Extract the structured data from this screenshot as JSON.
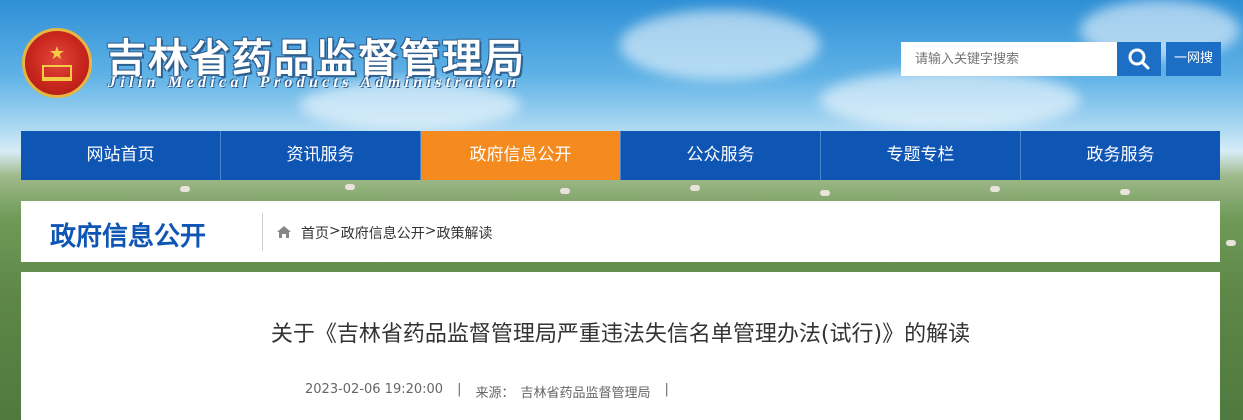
{
  "header": {
    "title": "吉林省药品监督管理局",
    "subtitle": "Jilin Medical Products Administration",
    "search_placeholder": "请输入关键字搜索",
    "search_button_icon": "search-icon",
    "one_net_label": "一网搜"
  },
  "nav": {
    "items": [
      {
        "label": "网站首页"
      },
      {
        "label": "资讯服务"
      },
      {
        "label": "政府信息公开"
      },
      {
        "label": "公众服务"
      },
      {
        "label": "专题专栏"
      },
      {
        "label": "政务服务"
      }
    ],
    "active_index": 2
  },
  "section": {
    "title": "政府信息公开",
    "breadcrumb": {
      "home": "首页",
      "sep1": ">",
      "level1": "政府信息公开",
      "sep2": ">",
      "level2": "政策解读"
    }
  },
  "article": {
    "title": "关于《吉林省药品监督管理局严重违法失信名单管理办法(试行)》的解读",
    "date": "2023-02-06 19:20:00",
    "sep": "|",
    "source_label": "来源：",
    "source_value": "吉林省药品监督管理局",
    "trailing_sep": "|"
  },
  "colors": {
    "primary": "#0f55b4",
    "active": "#f58a1f",
    "search_button": "#1d6ec5"
  }
}
